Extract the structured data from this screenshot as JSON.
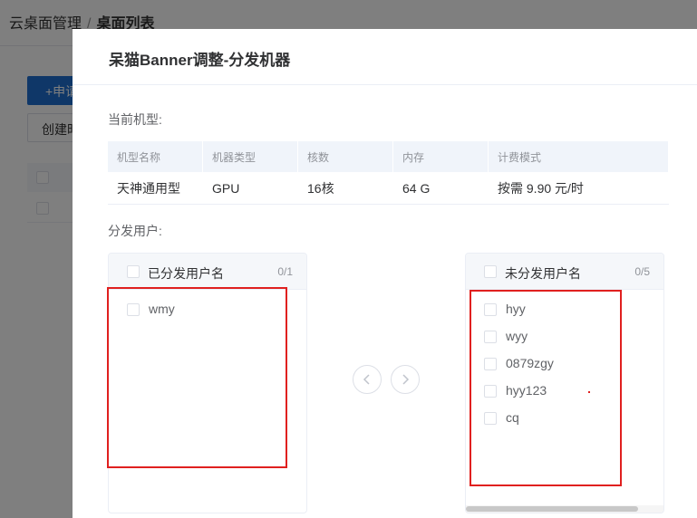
{
  "background": {
    "breadcrumb": {
      "parent": "云桌面管理",
      "separator": "/",
      "current": "桌面列表"
    },
    "apply_button": "+申请",
    "create_button": "创建时间"
  },
  "dialog": {
    "title": "呆猫Banner调整-分发机器",
    "current_model_label": "当前机型:",
    "spec_table": {
      "headers": [
        "机型名称",
        "机器类型",
        "核数",
        "内存",
        "计费模式"
      ],
      "row": [
        "天神通用型",
        "GPU",
        "16核",
        "64 G",
        "按需 9.90 元/时"
      ]
    },
    "distribute_users_label": "分发用户:",
    "left_panel": {
      "title": "已分发用户名",
      "count": "0/1",
      "items": [
        "wmy"
      ]
    },
    "right_panel": {
      "title": "未分发用户名",
      "count": "0/5",
      "items": [
        "hyy",
        "wyy",
        "0879zgy",
        "hyy123",
        "cq"
      ]
    },
    "move_left_icon": "chevron-left-icon",
    "move_right_icon": "chevron-right-icon"
  },
  "colors": {
    "primary": "#1f6fd0",
    "annotation_red": "#e0201f",
    "table_header_bg": "#f0f4fa"
  }
}
